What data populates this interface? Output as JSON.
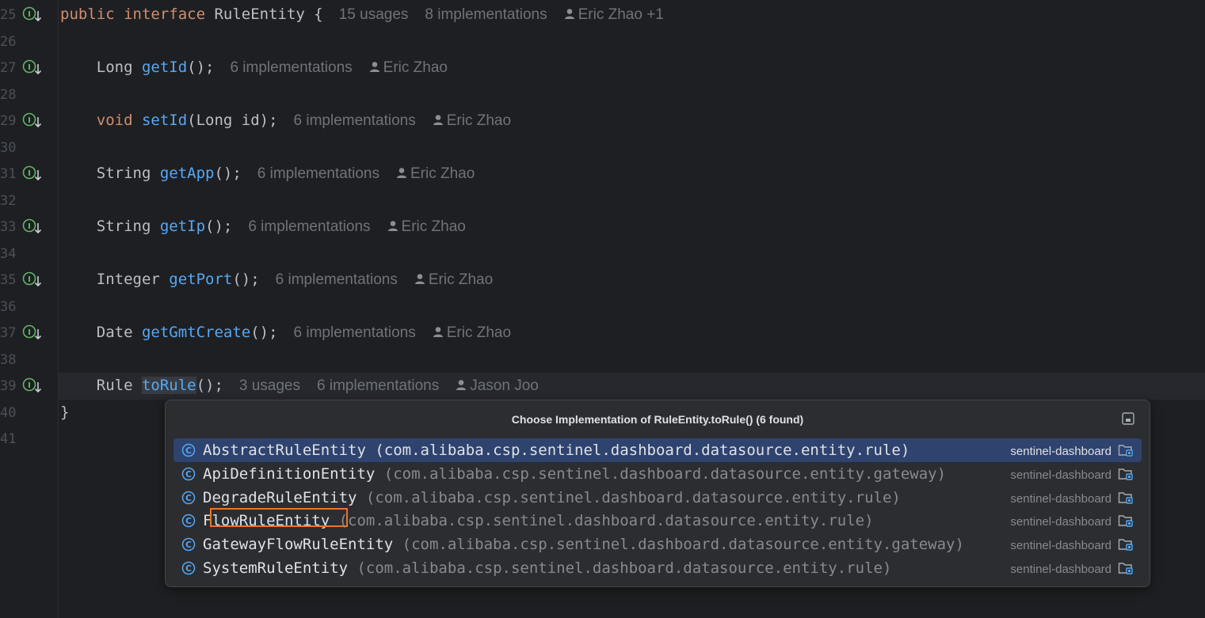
{
  "editor": {
    "lines": [
      {
        "num": "25",
        "parts": [
          {
            "t": "public ",
            "c": "kw"
          },
          {
            "t": "interface ",
            "c": "kw"
          },
          {
            "t": "RuleEntity {",
            "c": ""
          }
        ],
        "hints": [
          "15 usages",
          "8 implementations"
        ],
        "author": "Eric Zhao +1"
      },
      {
        "num": "26"
      },
      {
        "num": "27",
        "parts": [
          {
            "t": "    Long ",
            "c": ""
          },
          {
            "t": "getId",
            "c": "fn"
          },
          {
            "t": "();",
            "c": ""
          }
        ],
        "hints": [
          "6 implementations"
        ],
        "author": "Eric Zhao"
      },
      {
        "num": "28"
      },
      {
        "num": "29",
        "parts": [
          {
            "t": "    void ",
            "c": "kw"
          },
          {
            "t": "setId",
            "c": "fn"
          },
          {
            "t": "(Long id);",
            "c": ""
          }
        ],
        "hints": [
          "6 implementations"
        ],
        "author": "Eric Zhao"
      },
      {
        "num": "30"
      },
      {
        "num": "31",
        "parts": [
          {
            "t": "    String ",
            "c": ""
          },
          {
            "t": "getApp",
            "c": "fn"
          },
          {
            "t": "();",
            "c": ""
          }
        ],
        "hints": [
          "6 implementations"
        ],
        "author": "Eric Zhao"
      },
      {
        "num": "32"
      },
      {
        "num": "33",
        "parts": [
          {
            "t": "    String ",
            "c": ""
          },
          {
            "t": "getIp",
            "c": "fn"
          },
          {
            "t": "();",
            "c": ""
          }
        ],
        "hints": [
          "6 implementations"
        ],
        "author": "Eric Zhao"
      },
      {
        "num": "34"
      },
      {
        "num": "35",
        "parts": [
          {
            "t": "    Integer ",
            "c": ""
          },
          {
            "t": "getPort",
            "c": "fn"
          },
          {
            "t": "();",
            "c": ""
          }
        ],
        "hints": [
          "6 implementations"
        ],
        "author": "Eric Zhao"
      },
      {
        "num": "36"
      },
      {
        "num": "37",
        "parts": [
          {
            "t": "    Date ",
            "c": ""
          },
          {
            "t": "getGmtCreate",
            "c": "fn"
          },
          {
            "t": "();",
            "c": ""
          }
        ],
        "hints": [
          "6 implementations"
        ],
        "author": "Eric Zhao"
      },
      {
        "num": "38"
      },
      {
        "num": "39",
        "parts": [
          {
            "t": "    Rule ",
            "c": ""
          },
          {
            "t": "toRule",
            "c": "fn hl-word"
          },
          {
            "t": "();",
            "c": ""
          }
        ],
        "hints": [
          "3 usages",
          "6 implementations"
        ],
        "author": "Jason Joo"
      },
      {
        "num": "40",
        "parts": [
          {
            "t": "}",
            "c": ""
          }
        ]
      },
      {
        "num": "41"
      }
    ]
  },
  "popup": {
    "title": "Choose Implementation of RuleEntity.toRule() (6 found)",
    "items": [
      {
        "name": "AbstractRuleEntity",
        "pkg": "(com.alibaba.csp.sentinel.dashboard.datasource.entity.rule)",
        "module": "sentinel-dashboard",
        "selected": true
      },
      {
        "name": "ApiDefinitionEntity",
        "pkg": "(com.alibaba.csp.sentinel.dashboard.datasource.entity.gateway)",
        "module": "sentinel-dashboard"
      },
      {
        "name": "DegradeRuleEntity",
        "pkg": "(com.alibaba.csp.sentinel.dashboard.datasource.entity.rule)",
        "module": "sentinel-dashboard"
      },
      {
        "name": "FlowRuleEntity",
        "pkg": "(com.alibaba.csp.sentinel.dashboard.datasource.entity.rule)",
        "module": "sentinel-dashboard",
        "focused": true
      },
      {
        "name": "GatewayFlowRuleEntity",
        "pkg": "(com.alibaba.csp.sentinel.dashboard.datasource.entity.gateway)",
        "module": "sentinel-dashboard"
      },
      {
        "name": "SystemRuleEntity",
        "pkg": "(com.alibaba.csp.sentinel.dashboard.datasource.entity.rule)",
        "module": "sentinel-dashboard"
      }
    ]
  },
  "icons": {
    "implemented": "implemented-down-arrow-icon",
    "user": "user-icon",
    "class": "class-icon",
    "module": "module-folder-icon",
    "pin": "open-in-window-icon"
  },
  "colors": {
    "background": "#1e1f22",
    "keyword": "#cf8e6d",
    "method": "#56a8f5",
    "selection": "#2e436e",
    "focus": "#e8772e",
    "implIcon": "#5fb865"
  }
}
